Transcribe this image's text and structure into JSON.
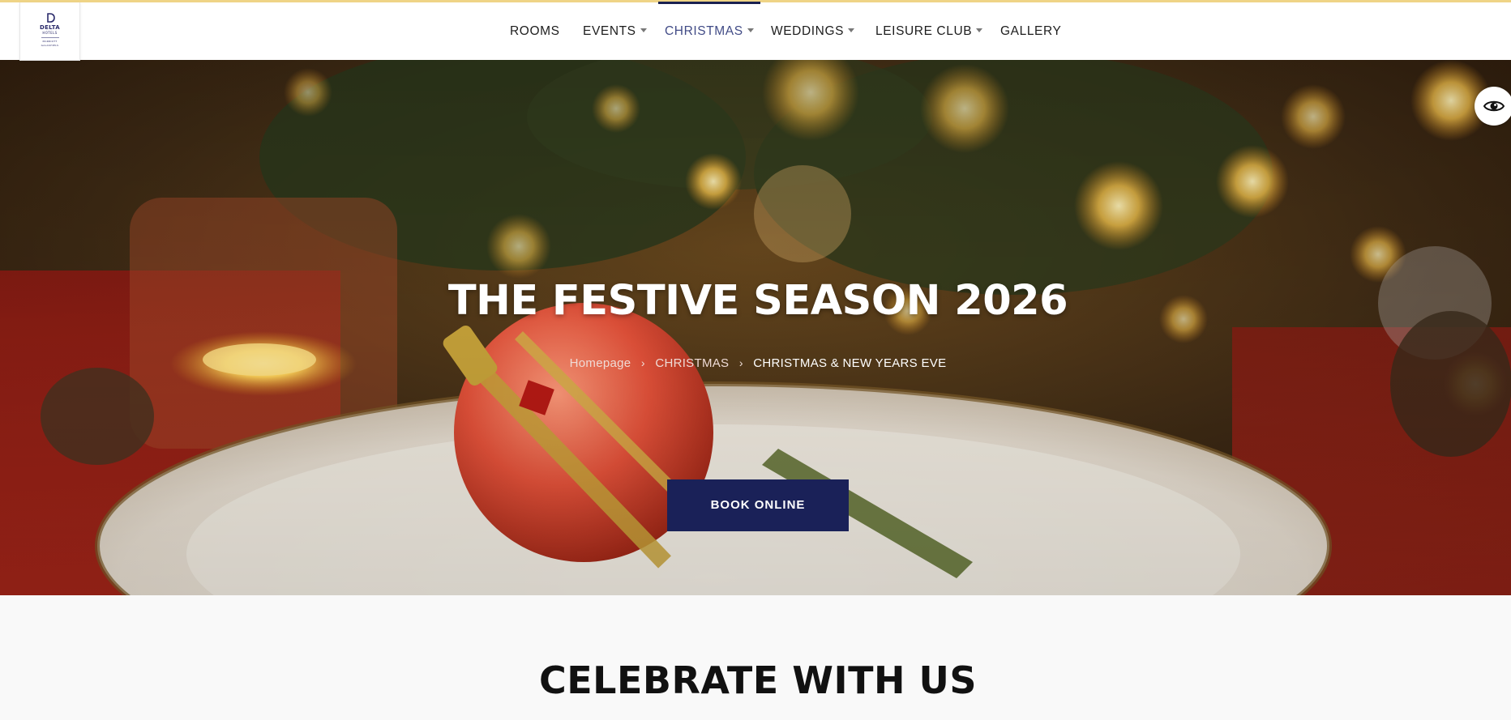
{
  "header": {
    "logo": {
      "brand": "DELTA",
      "sub": "HOTELS",
      "tiny1": "MARRIOTT",
      "tiny2": "GALASHIELS",
      "icon": "delta-d-logo-mark"
    },
    "nav": [
      {
        "label": "ROOMS",
        "has_dropdown": false,
        "active": false
      },
      {
        "label": "EVENTS",
        "has_dropdown": true,
        "active": false
      },
      {
        "label": "CHRISTMAS",
        "has_dropdown": true,
        "active": true
      },
      {
        "label": "WEDDINGS",
        "has_dropdown": true,
        "active": false
      },
      {
        "label": "LEISURE CLUB",
        "has_dropdown": true,
        "active": false
      },
      {
        "label": "GALLERY",
        "has_dropdown": false,
        "active": false
      }
    ]
  },
  "hero": {
    "title": "THE FESTIVE SEASON 2026",
    "breadcrumb": [
      {
        "label": "Homepage"
      },
      {
        "label": "CHRISTMAS"
      },
      {
        "label": "CHRISTMAS & NEW YEARS EVE"
      }
    ],
    "cta_label": "BOOK ONLINE",
    "accessibility_icon": "eye-icon"
  },
  "section": {
    "title": "CELEBRATE WITH US"
  },
  "colors": {
    "accent_navy": "#1a2158",
    "top_line_gold": "#efd486",
    "active_nav_text": "#414b86"
  }
}
